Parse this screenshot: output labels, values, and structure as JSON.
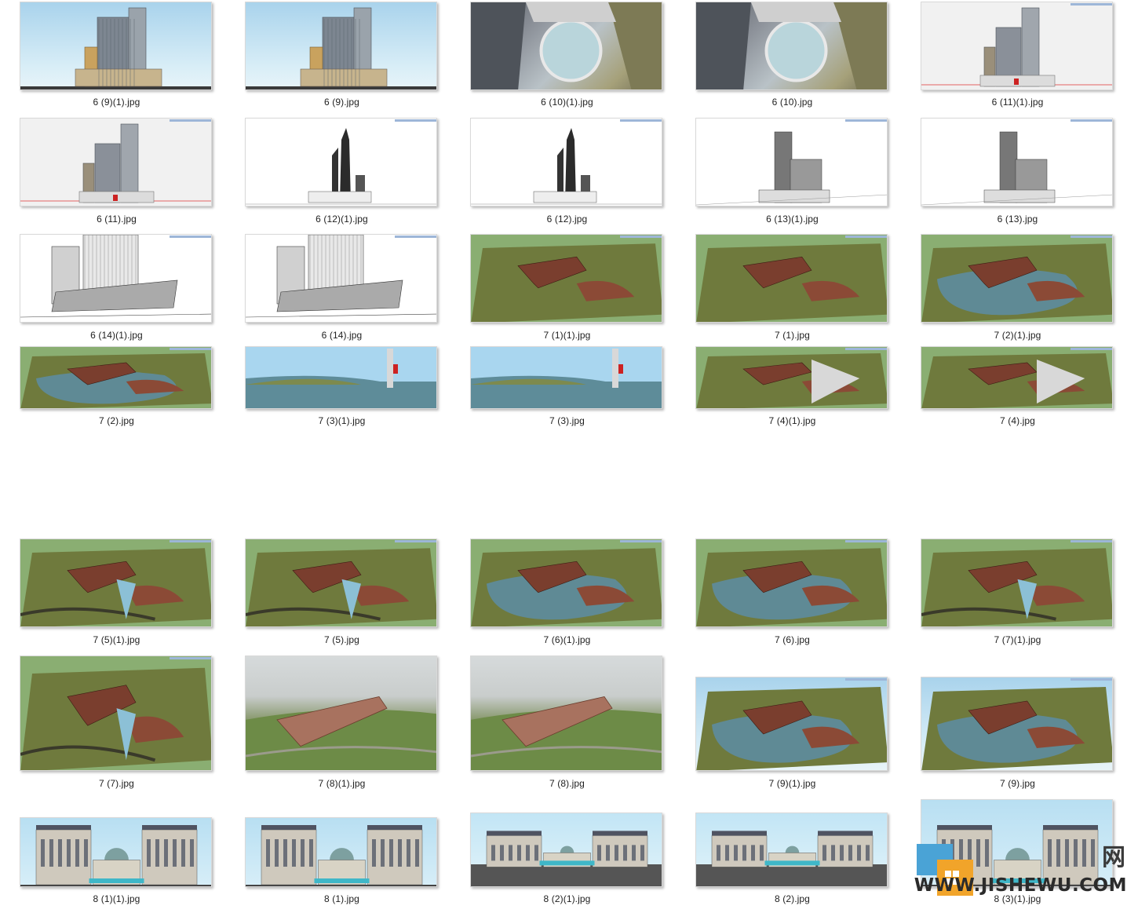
{
  "files": [
    {
      "name": "6 (9)(1).jpg",
      "kind": "tower-sky"
    },
    {
      "name": "6 (9).jpg",
      "kind": "tower-sky"
    },
    {
      "name": "6 (10)(1).jpg",
      "kind": "aerial-city"
    },
    {
      "name": "6 (10).jpg",
      "kind": "aerial-city"
    },
    {
      "name": "6 (11)(1).jpg",
      "kind": "tower-grey"
    },
    {
      "name": "6 (11).jpg",
      "kind": "tower-grey"
    },
    {
      "name": "6 (12)(1).jpg",
      "kind": "tower-white"
    },
    {
      "name": "6 (12).jpg",
      "kind": "tower-white"
    },
    {
      "name": "6 (13)(1).jpg",
      "kind": "tower-white2"
    },
    {
      "name": "6 (13).jpg",
      "kind": "tower-white2"
    },
    {
      "name": "6 (14)(1).jpg",
      "kind": "tower-line"
    },
    {
      "name": "6 (14).jpg",
      "kind": "tower-line"
    },
    {
      "name": "7 (1)(1).jpg",
      "kind": "terrain"
    },
    {
      "name": "7 (1).jpg",
      "kind": "terrain"
    },
    {
      "name": "7 (2)(1).jpg",
      "kind": "terrain-lake"
    },
    {
      "name": "7 (2).jpg",
      "kind": "terrain-lake"
    },
    {
      "name": "7 (3)(1).jpg",
      "kind": "terrain-sky"
    },
    {
      "name": "7 (3).jpg",
      "kind": "terrain-sky"
    },
    {
      "name": "7 (4)(1).jpg",
      "kind": "terrain-close"
    },
    {
      "name": "7 (4).jpg",
      "kind": "terrain-close"
    },
    {
      "name": "7 (5)(1).jpg",
      "kind": "terrain-hill"
    },
    {
      "name": "7 (5).jpg",
      "kind": "terrain-hill"
    },
    {
      "name": "7 (6)(1).jpg",
      "kind": "terrain-lake"
    },
    {
      "name": "7 (6).jpg",
      "kind": "terrain-lake"
    },
    {
      "name": "7 (7)(1).jpg",
      "kind": "terrain-hill"
    },
    {
      "name": "7 (7).jpg",
      "kind": "terrain-hill"
    },
    {
      "name": "7 (8)(1).jpg",
      "kind": "render"
    },
    {
      "name": "7 (8).jpg",
      "kind": "render"
    },
    {
      "name": "7 (9)(1).jpg",
      "kind": "terrain-lake2"
    },
    {
      "name": "7 (9).jpg",
      "kind": "terrain-lake2"
    },
    {
      "name": "8 (1)(1).jpg",
      "kind": "elevation"
    },
    {
      "name": "8 (1).jpg",
      "kind": "elevation"
    },
    {
      "name": "8 (2)(1).jpg",
      "kind": "elevation-dark"
    },
    {
      "name": "8 (2).jpg",
      "kind": "elevation-dark"
    },
    {
      "name": "8 (3)(1).jpg",
      "kind": "elevation"
    }
  ],
  "watermark": {
    "site_url": "WWW.JISHEWU.COM",
    "site_cn": "网"
  },
  "colors": {
    "caption": "#1e1e1e",
    "water": "#5f8a95",
    "grass": "#8aae72",
    "brown": "#7a3e2e"
  }
}
